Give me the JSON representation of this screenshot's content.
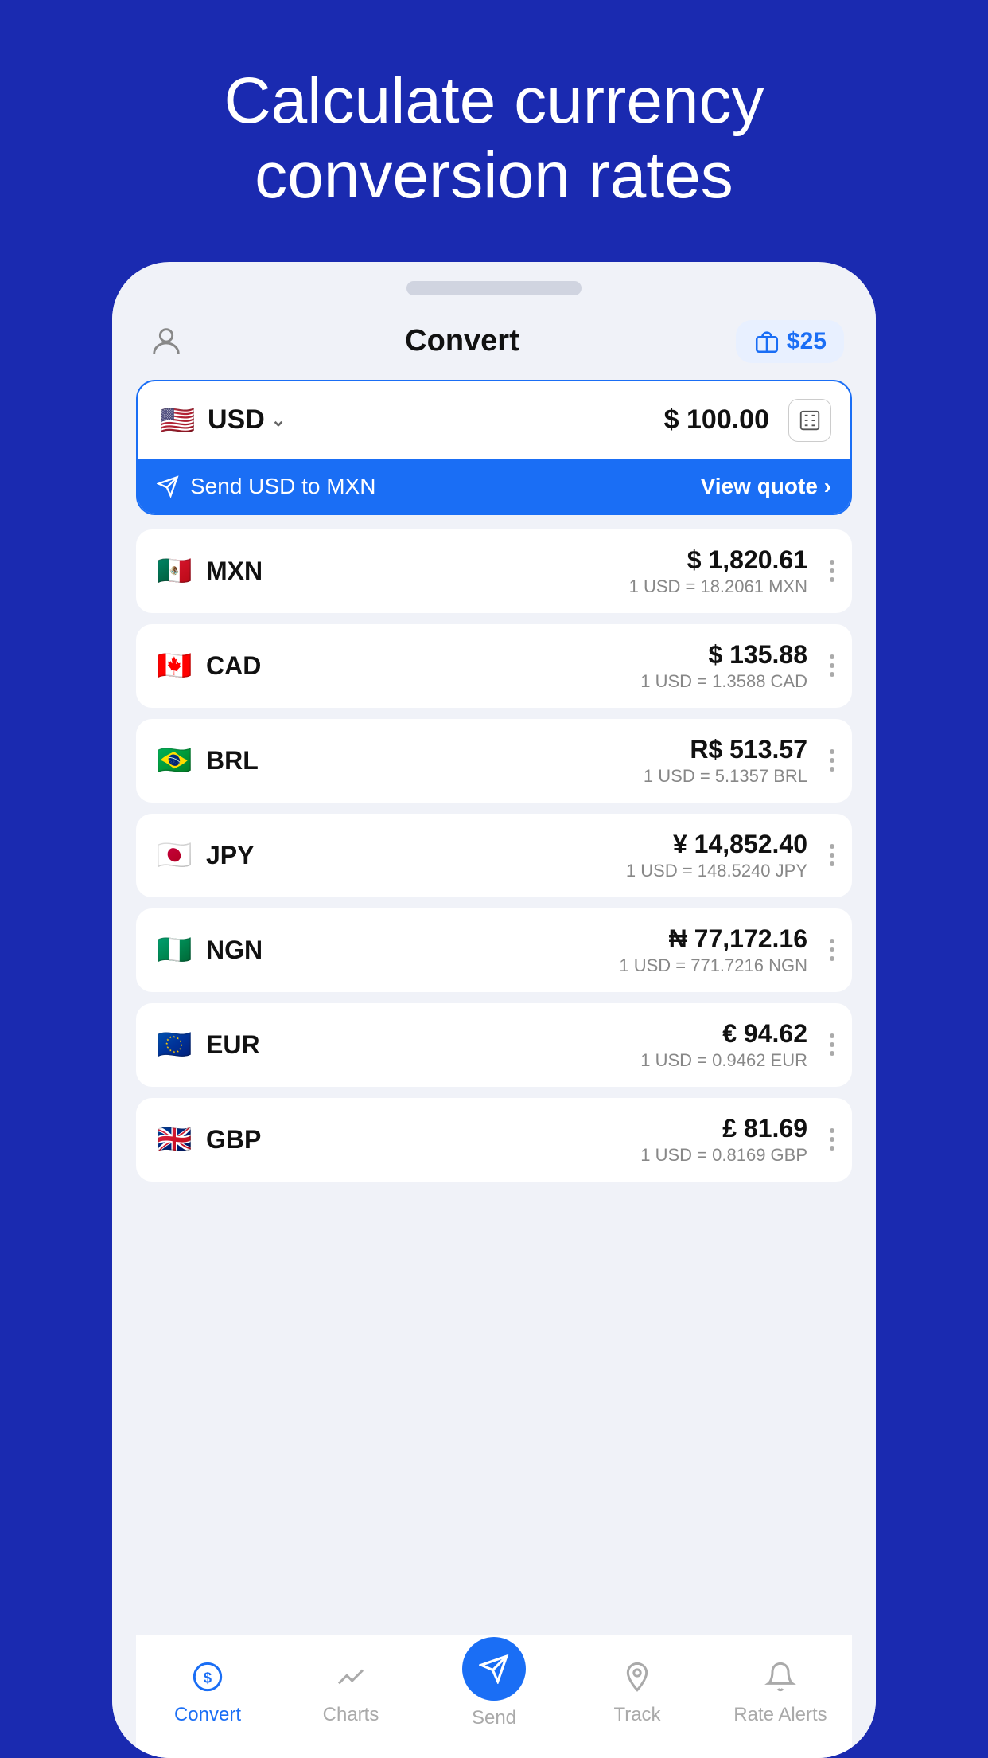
{
  "hero": {
    "line1": "Calculate currency",
    "line2": "conversion rates"
  },
  "header": {
    "title": "Convert",
    "promo": "$25"
  },
  "base_currency": {
    "code": "USD",
    "flag": "🇺🇸",
    "amount": "$ 100.00"
  },
  "send_banner": {
    "text": "Send USD to MXN",
    "cta": "View quote ›"
  },
  "currencies": [
    {
      "code": "MXN",
      "flag": "🇲🇽",
      "amount": "$ 1,820.61",
      "rate": "1 USD = 18.2061 MXN"
    },
    {
      "code": "CAD",
      "flag": "🇨🇦",
      "amount": "$ 135.88",
      "rate": "1 USD = 1.3588 CAD"
    },
    {
      "code": "BRL",
      "flag": "🇧🇷",
      "amount": "R$ 513.57",
      "rate": "1 USD = 5.1357 BRL"
    },
    {
      "code": "JPY",
      "flag": "🇯🇵",
      "amount": "¥ 14,852.40",
      "rate": "1 USD = 148.5240 JPY"
    },
    {
      "code": "NGN",
      "flag": "🇳🇬",
      "amount": "₦ 77,172.16",
      "rate": "1 USD = 771.7216 NGN"
    },
    {
      "code": "EUR",
      "flag": "🇪🇺",
      "amount": "€ 94.62",
      "rate": "1 USD = 0.9462 EUR"
    },
    {
      "code": "GBP",
      "flag": "🇬🇧",
      "amount": "£ 81.69",
      "rate": "1 USD = 0.8169 GBP"
    }
  ],
  "nav": {
    "items": [
      {
        "label": "Convert",
        "active": true
      },
      {
        "label": "Charts",
        "active": false
      },
      {
        "label": "Send",
        "active": false,
        "is_send": true
      },
      {
        "label": "Track",
        "active": false
      },
      {
        "label": "Rate Alerts",
        "active": false
      }
    ]
  }
}
